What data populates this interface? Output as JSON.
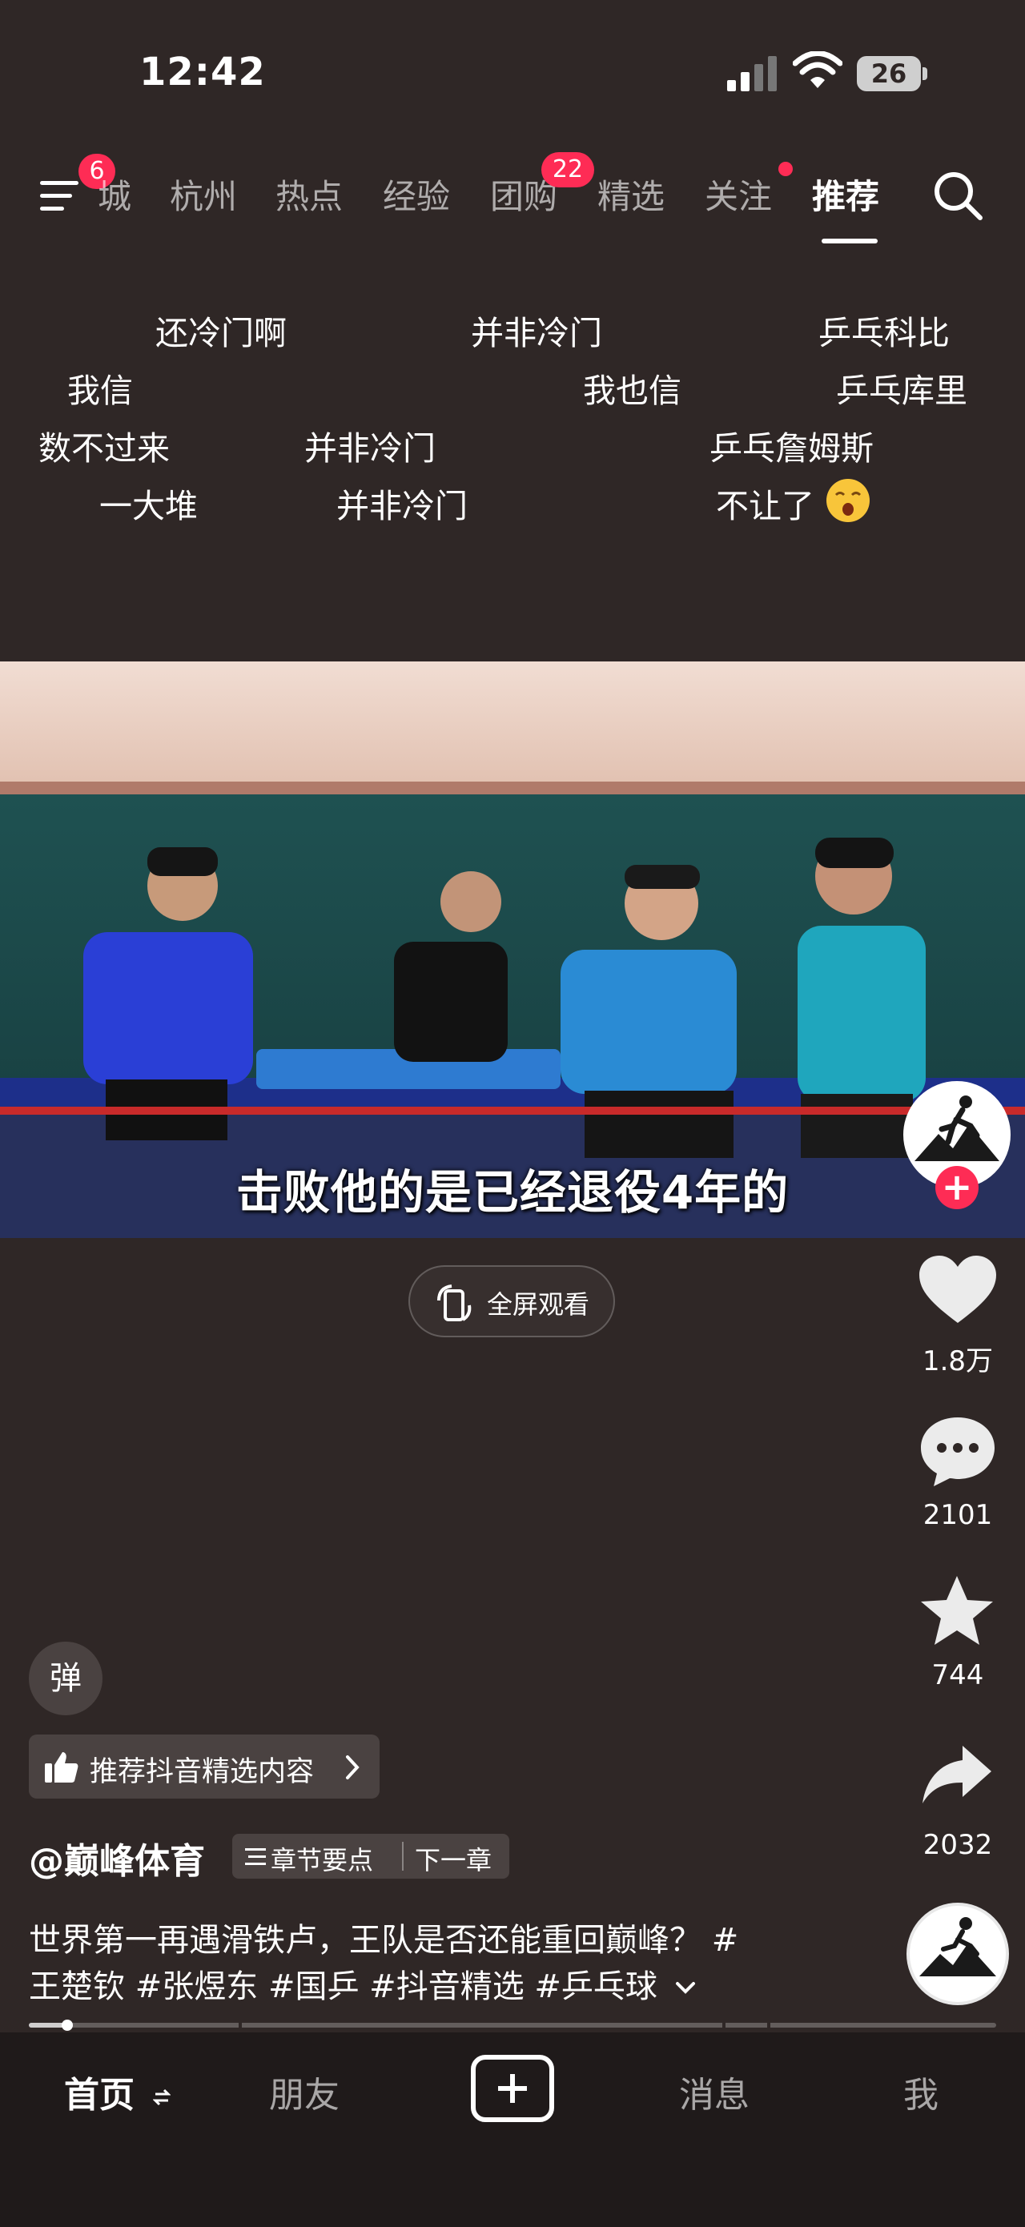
{
  "status_bar": {
    "time": "12:42",
    "battery": "26"
  },
  "nav": {
    "menu_badge": "6",
    "tabs": [
      {
        "label": "城",
        "badge": ""
      },
      {
        "label": "杭州",
        "badge": ""
      },
      {
        "label": "热点",
        "badge": ""
      },
      {
        "label": "经验",
        "badge": ""
      },
      {
        "label": "团购",
        "badge": "22"
      },
      {
        "label": "精选",
        "badge": ""
      },
      {
        "label": "关注",
        "badge": ""
      },
      {
        "label": "推荐",
        "badge": ""
      }
    ],
    "active_tab": "推荐"
  },
  "danmaku": [
    "还冷门啊",
    "并非冷门",
    "乒乓科比",
    "我信",
    "我也信",
    "乒乓库里",
    "数不过来",
    "并非冷门",
    "乒乓詹姆斯",
    "一大堆",
    "并非冷门",
    "不让了"
  ],
  "video": {
    "subtitle": "击败他的是已经退役4年的"
  },
  "fullscreen_label": "全屏观看",
  "rail": {
    "likes": "1.8万",
    "comments": "2101",
    "favorites": "744",
    "shares": "2032",
    "avatar_text": "巅峰体育"
  },
  "danmaku_toggle": "弹",
  "recommend_chip": "推荐抖音精选内容",
  "author": "@巅峰体育",
  "chapter": {
    "points": "章节要点",
    "next": "下一章"
  },
  "description": {
    "line1": "世界第一再遇滑铁卢，王队是否还能重回巅峰？ #",
    "line2": "王楚钦 #张煜东 #国乒 #抖音精选 #乒乓球"
  },
  "progress": {
    "played_fraction": 0.04
  },
  "tabbar": {
    "home": "首页",
    "friends": "朋友",
    "messages": "消息",
    "me": "我"
  },
  "colors": {
    "accent": "#fe2c55",
    "background": "#2f2726",
    "tabbar": "#1f1a1a"
  }
}
